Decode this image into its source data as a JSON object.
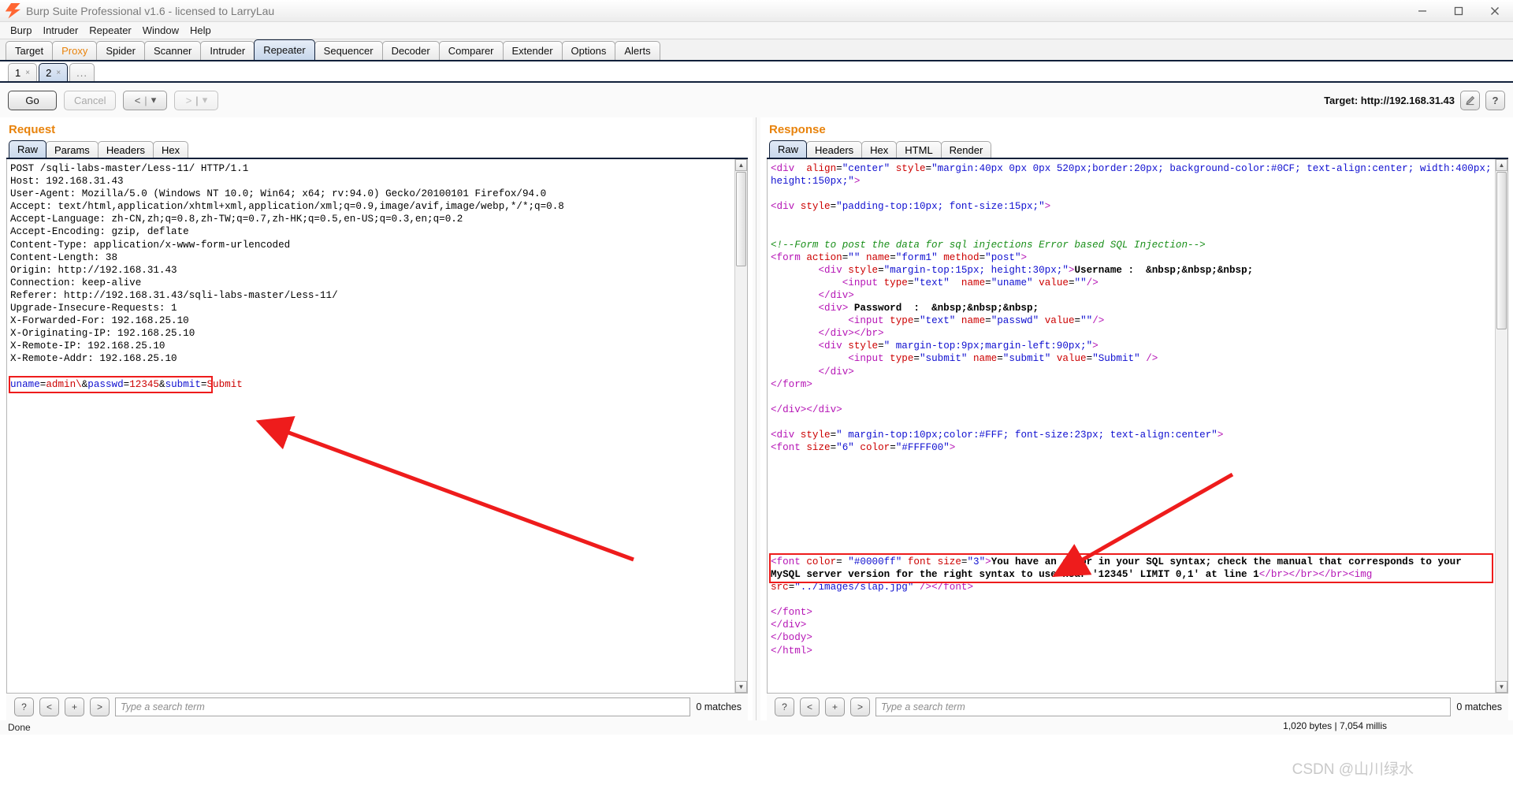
{
  "window": {
    "title": "Burp Suite Professional v1.6 - licensed to LarryLau",
    "icon": "burp-bolt-icon",
    "minimize": "–",
    "maximize": "❐",
    "close": "✕"
  },
  "menubar": {
    "items": [
      {
        "label": "Burp"
      },
      {
        "label": "Intruder"
      },
      {
        "label": "Repeater"
      },
      {
        "label": "Window"
      },
      {
        "label": "Help"
      }
    ]
  },
  "main_tabs": {
    "selected": "Repeater",
    "items": [
      {
        "label": "Target",
        "accent": false
      },
      {
        "label": "Proxy",
        "accent": true
      },
      {
        "label": "Spider",
        "accent": false
      },
      {
        "label": "Scanner",
        "accent": false
      },
      {
        "label": "Intruder",
        "accent": false
      },
      {
        "label": "Repeater",
        "accent": false
      },
      {
        "label": "Sequencer",
        "accent": false
      },
      {
        "label": "Decoder",
        "accent": false
      },
      {
        "label": "Comparer",
        "accent": false
      },
      {
        "label": "Extender",
        "accent": false
      },
      {
        "label": "Options",
        "accent": false
      },
      {
        "label": "Alerts",
        "accent": false
      }
    ]
  },
  "repeater_tabs": {
    "selected": "2",
    "items": [
      {
        "label": "1",
        "close": "×"
      },
      {
        "label": "2",
        "close": "×"
      }
    ],
    "more": "..."
  },
  "toolbar": {
    "go_label": "Go",
    "cancel_label": "Cancel",
    "back_label": "<",
    "forward_label": ">",
    "separator": "|",
    "caret": "▾",
    "target_label": "Target: http://192.168.31.43",
    "edit_icon": "pencil-icon",
    "help_icon": "question-icon",
    "help_label": "?"
  },
  "request": {
    "title": "Request",
    "tabs": [
      {
        "label": "Raw"
      },
      {
        "label": "Params"
      },
      {
        "label": "Headers"
      },
      {
        "label": "Hex"
      }
    ],
    "selected_tab": "Raw",
    "lines": [
      "POST /sqli-labs-master/Less-11/ HTTP/1.1",
      "Host: 192.168.31.43",
      "User-Agent: Mozilla/5.0 (Windows NT 10.0; Win64; x64; rv:94.0) Gecko/20100101 Firefox/94.0",
      "Accept: text/html,application/xhtml+xml,application/xml;q=0.9,image/avif,image/webp,*/*;q=0.8",
      "Accept-Language: zh-CN,zh;q=0.8,zh-TW;q=0.7,zh-HK;q=0.5,en-US;q=0.3,en;q=0.2",
      "Accept-Encoding: gzip, deflate",
      "Content-Type: application/x-www-form-urlencoded",
      "Content-Length: 38",
      "Origin: http://192.168.31.43",
      "Connection: keep-alive",
      "Referer: http://192.168.31.43/sqli-labs-master/Less-11/",
      "Upgrade-Insecure-Requests: 1",
      "X-Forwarded-For: 192.168.25.10",
      "X-Originating-IP: 192.168.25.10",
      "X-Remote-IP: 192.168.25.10",
      "X-Remote-Addr: 192.168.25.10",
      ""
    ],
    "body_highlighted": {
      "parts": [
        {
          "text": "uname",
          "color": "blue"
        },
        {
          "text": "=",
          "color": "black"
        },
        {
          "text": "admin\\",
          "color": "red"
        },
        {
          "text": "&",
          "color": "black"
        },
        {
          "text": "passwd",
          "color": "blue"
        },
        {
          "text": "=",
          "color": "black"
        },
        {
          "text": "12345",
          "color": "red"
        },
        {
          "text": "&",
          "color": "black"
        },
        {
          "text": "submit",
          "color": "blue"
        },
        {
          "text": "=",
          "color": "black"
        },
        {
          "text": "Submit",
          "color": "red"
        }
      ],
      "plain": "uname=admin\\&passwd=12345&submit=Submit"
    },
    "find": {
      "help_label": "?",
      "prev_label": "<",
      "add_label": "+",
      "next_label": ">",
      "placeholder": "Type a search term",
      "value": "",
      "matches": "0 matches"
    }
  },
  "response": {
    "title": "Response",
    "tabs": [
      {
        "label": "Raw"
      },
      {
        "label": "Headers"
      },
      {
        "label": "Hex"
      },
      {
        "label": "HTML"
      },
      {
        "label": "Render"
      }
    ],
    "selected_tab": "Raw",
    "lines": [
      [
        {
          "t": "<div",
          "c": "tag"
        },
        {
          "t": "  ",
          "c": "plain"
        },
        {
          "t": "align",
          "c": "attr"
        },
        {
          "t": "=",
          "c": "plain"
        },
        {
          "t": "\"center\"",
          "c": "val"
        },
        {
          "t": " ",
          "c": "plain"
        },
        {
          "t": "style",
          "c": "attr"
        },
        {
          "t": "=",
          "c": "plain"
        },
        {
          "t": "\"margin:40px 0px 0px 520px;border:20px; background-color:#0CF; text-align:center; width:400px;",
          "c": "val"
        }
      ],
      [
        {
          "t": "height:150px;\"",
          "c": "val"
        },
        {
          "t": ">",
          "c": "tag"
        }
      ],
      [
        {
          "t": "",
          "c": "plain"
        }
      ],
      [
        {
          "t": "<div",
          "c": "tag"
        },
        {
          "t": " ",
          "c": "plain"
        },
        {
          "t": "style",
          "c": "attr"
        },
        {
          "t": "=",
          "c": "plain"
        },
        {
          "t": "\"padding-top:10px; font-size:15px;\"",
          "c": "val"
        },
        {
          "t": ">",
          "c": "tag"
        }
      ],
      [
        {
          "t": "",
          "c": "plain"
        }
      ],
      [
        {
          "t": "",
          "c": "plain"
        }
      ],
      [
        {
          "t": "<!--Form to post the data for sql injections Error based SQL Injection-->",
          "c": "cmt"
        }
      ],
      [
        {
          "t": "<form",
          "c": "tag"
        },
        {
          "t": " ",
          "c": "plain"
        },
        {
          "t": "action",
          "c": "attr"
        },
        {
          "t": "=",
          "c": "plain"
        },
        {
          "t": "\"\"",
          "c": "val"
        },
        {
          "t": " ",
          "c": "plain"
        },
        {
          "t": "name",
          "c": "attr"
        },
        {
          "t": "=",
          "c": "plain"
        },
        {
          "t": "\"form1\"",
          "c": "val"
        },
        {
          "t": " ",
          "c": "plain"
        },
        {
          "t": "method",
          "c": "attr"
        },
        {
          "t": "=",
          "c": "plain"
        },
        {
          "t": "\"post\"",
          "c": "val"
        },
        {
          "t": ">",
          "c": "tag"
        }
      ],
      [
        {
          "t": "        ",
          "c": "plain"
        },
        {
          "t": "<div",
          "c": "tag"
        },
        {
          "t": " ",
          "c": "plain"
        },
        {
          "t": "style",
          "c": "attr"
        },
        {
          "t": "=",
          "c": "plain"
        },
        {
          "t": "\"margin-top:15px; height:30px;\"",
          "c": "val"
        },
        {
          "t": ">",
          "c": "tag"
        },
        {
          "t": "Username :  &nbsp;&nbsp;&nbsp;",
          "c": "txt"
        }
      ],
      [
        {
          "t": "            ",
          "c": "plain"
        },
        {
          "t": "<input",
          "c": "tag"
        },
        {
          "t": " ",
          "c": "plain"
        },
        {
          "t": "type",
          "c": "attr"
        },
        {
          "t": "=",
          "c": "plain"
        },
        {
          "t": "\"text\"",
          "c": "val"
        },
        {
          "t": "  ",
          "c": "plain"
        },
        {
          "t": "name",
          "c": "attr"
        },
        {
          "t": "=",
          "c": "plain"
        },
        {
          "t": "\"uname\"",
          "c": "val"
        },
        {
          "t": " ",
          "c": "plain"
        },
        {
          "t": "value",
          "c": "attr"
        },
        {
          "t": "=",
          "c": "plain"
        },
        {
          "t": "\"\"",
          "c": "val"
        },
        {
          "t": "/>",
          "c": "tag"
        }
      ],
      [
        {
          "t": "        ",
          "c": "plain"
        },
        {
          "t": "</div>",
          "c": "tag"
        }
      ],
      [
        {
          "t": "        ",
          "c": "plain"
        },
        {
          "t": "<div>",
          "c": "tag"
        },
        {
          "t": " Password  :  &nbsp;&nbsp;&nbsp;",
          "c": "txt"
        }
      ],
      [
        {
          "t": "             ",
          "c": "plain"
        },
        {
          "t": "<input",
          "c": "tag"
        },
        {
          "t": " ",
          "c": "plain"
        },
        {
          "t": "type",
          "c": "attr"
        },
        {
          "t": "=",
          "c": "plain"
        },
        {
          "t": "\"text\"",
          "c": "val"
        },
        {
          "t": " ",
          "c": "plain"
        },
        {
          "t": "name",
          "c": "attr"
        },
        {
          "t": "=",
          "c": "plain"
        },
        {
          "t": "\"passwd\"",
          "c": "val"
        },
        {
          "t": " ",
          "c": "plain"
        },
        {
          "t": "value",
          "c": "attr"
        },
        {
          "t": "=",
          "c": "plain"
        },
        {
          "t": "\"\"",
          "c": "val"
        },
        {
          "t": "/>",
          "c": "tag"
        }
      ],
      [
        {
          "t": "        ",
          "c": "plain"
        },
        {
          "t": "</div></br>",
          "c": "tag"
        }
      ],
      [
        {
          "t": "        ",
          "c": "plain"
        },
        {
          "t": "<div",
          "c": "tag"
        },
        {
          "t": " ",
          "c": "plain"
        },
        {
          "t": "style",
          "c": "attr"
        },
        {
          "t": "=",
          "c": "plain"
        },
        {
          "t": "\" margin-top:9px;margin-left:90px;\"",
          "c": "val"
        },
        {
          "t": ">",
          "c": "tag"
        }
      ],
      [
        {
          "t": "             ",
          "c": "plain"
        },
        {
          "t": "<input",
          "c": "tag"
        },
        {
          "t": " ",
          "c": "plain"
        },
        {
          "t": "type",
          "c": "attr"
        },
        {
          "t": "=",
          "c": "plain"
        },
        {
          "t": "\"submit\"",
          "c": "val"
        },
        {
          "t": " ",
          "c": "plain"
        },
        {
          "t": "name",
          "c": "attr"
        },
        {
          "t": "=",
          "c": "plain"
        },
        {
          "t": "\"submit\"",
          "c": "val"
        },
        {
          "t": " ",
          "c": "plain"
        },
        {
          "t": "value",
          "c": "attr"
        },
        {
          "t": "=",
          "c": "plain"
        },
        {
          "t": "\"Submit\"",
          "c": "val"
        },
        {
          "t": " />",
          "c": "tag"
        }
      ],
      [
        {
          "t": "        ",
          "c": "plain"
        },
        {
          "t": "</div>",
          "c": "tag"
        }
      ],
      [
        {
          "t": "</form>",
          "c": "tag"
        }
      ],
      [
        {
          "t": "",
          "c": "plain"
        }
      ],
      [
        {
          "t": "</div></div>",
          "c": "tag"
        }
      ],
      [
        {
          "t": "",
          "c": "plain"
        }
      ],
      [
        {
          "t": "<div",
          "c": "tag"
        },
        {
          "t": " ",
          "c": "plain"
        },
        {
          "t": "style",
          "c": "attr"
        },
        {
          "t": "=",
          "c": "plain"
        },
        {
          "t": "\" margin-top:10px;color:#FFF; font-size:23px; text-align:center\"",
          "c": "val"
        },
        {
          "t": ">",
          "c": "tag"
        }
      ],
      [
        {
          "t": "<font",
          "c": "tag"
        },
        {
          "t": " ",
          "c": "plain"
        },
        {
          "t": "size",
          "c": "attr"
        },
        {
          "t": "=",
          "c": "plain"
        },
        {
          "t": "\"6\"",
          "c": "val"
        },
        {
          "t": " ",
          "c": "plain"
        },
        {
          "t": "color",
          "c": "attr"
        },
        {
          "t": "=",
          "c": "plain"
        },
        {
          "t": "\"#FFFF00\"",
          "c": "val"
        },
        {
          "t": ">",
          "c": "tag"
        }
      ]
    ],
    "error_block": {
      "line1": [
        {
          "t": "<font",
          "c": "tag"
        },
        {
          "t": " ",
          "c": "plain"
        },
        {
          "t": "color",
          "c": "attr"
        },
        {
          "t": "= ",
          "c": "plain"
        },
        {
          "t": "\"#0000ff\"",
          "c": "val"
        },
        {
          "t": " ",
          "c": "plain"
        },
        {
          "t": "font",
          "c": "attr"
        },
        {
          "t": " ",
          "c": "plain"
        },
        {
          "t": "size",
          "c": "attr"
        },
        {
          "t": "=",
          "c": "plain"
        },
        {
          "t": "\"3\"",
          "c": "val"
        },
        {
          "t": ">",
          "c": "tag"
        },
        {
          "t": "You have an error in your SQL syntax; check the manual that corresponds to your",
          "c": "txt"
        }
      ],
      "line2": [
        {
          "t": "MySQL server version for the right syntax to use near '12345' LIMIT 0,1' at line 1",
          "c": "txt"
        },
        {
          "t": "</br></br></br>",
          "c": "tag"
        },
        {
          "t": "<img",
          "c": "tag"
        }
      ],
      "line3": [
        {
          "t": "src",
          "c": "attr"
        },
        {
          "t": "=",
          "c": "plain"
        },
        {
          "t": "\"../images/slap.jpg\"",
          "c": "val"
        },
        {
          "t": " />",
          "c": "tag"
        },
        {
          "t": "</font>",
          "c": "tag"
        }
      ]
    },
    "tail_lines": [
      [
        {
          "t": "",
          "c": "plain"
        }
      ],
      [
        {
          "t": "</font>",
          "c": "tag"
        }
      ],
      [
        {
          "t": "</div>",
          "c": "tag"
        }
      ],
      [
        {
          "t": "</body>",
          "c": "tag"
        }
      ],
      [
        {
          "t": "</html>",
          "c": "tag"
        }
      ]
    ],
    "find": {
      "help_label": "?",
      "prev_label": "<",
      "add_label": "+",
      "next_label": ">",
      "placeholder": "Type a search term",
      "value": "",
      "matches": "0 matches"
    }
  },
  "status": {
    "left_text": "Done",
    "bytes_text": "1,020 bytes | 7,054 millis"
  },
  "watermark": {
    "text": "CSDN @山川绿水"
  },
  "colors": {
    "accent_orange": "#e8830c",
    "annotation_red": "#ee1c1c",
    "tab_selected": "#c9d8ec",
    "tag_purple": "#b514b5",
    "attr_red": "#cc0000",
    "value_blue": "#0f0fd0",
    "comment_green": "#1a8f1a"
  },
  "annotations": {
    "arrow_left": "red-arrow-pointing-to-request-body",
    "arrow_right": "red-arrow-pointing-to-sql-error",
    "box_request_body": "red-highlight-box",
    "box_sql_error": "red-highlight-box"
  }
}
